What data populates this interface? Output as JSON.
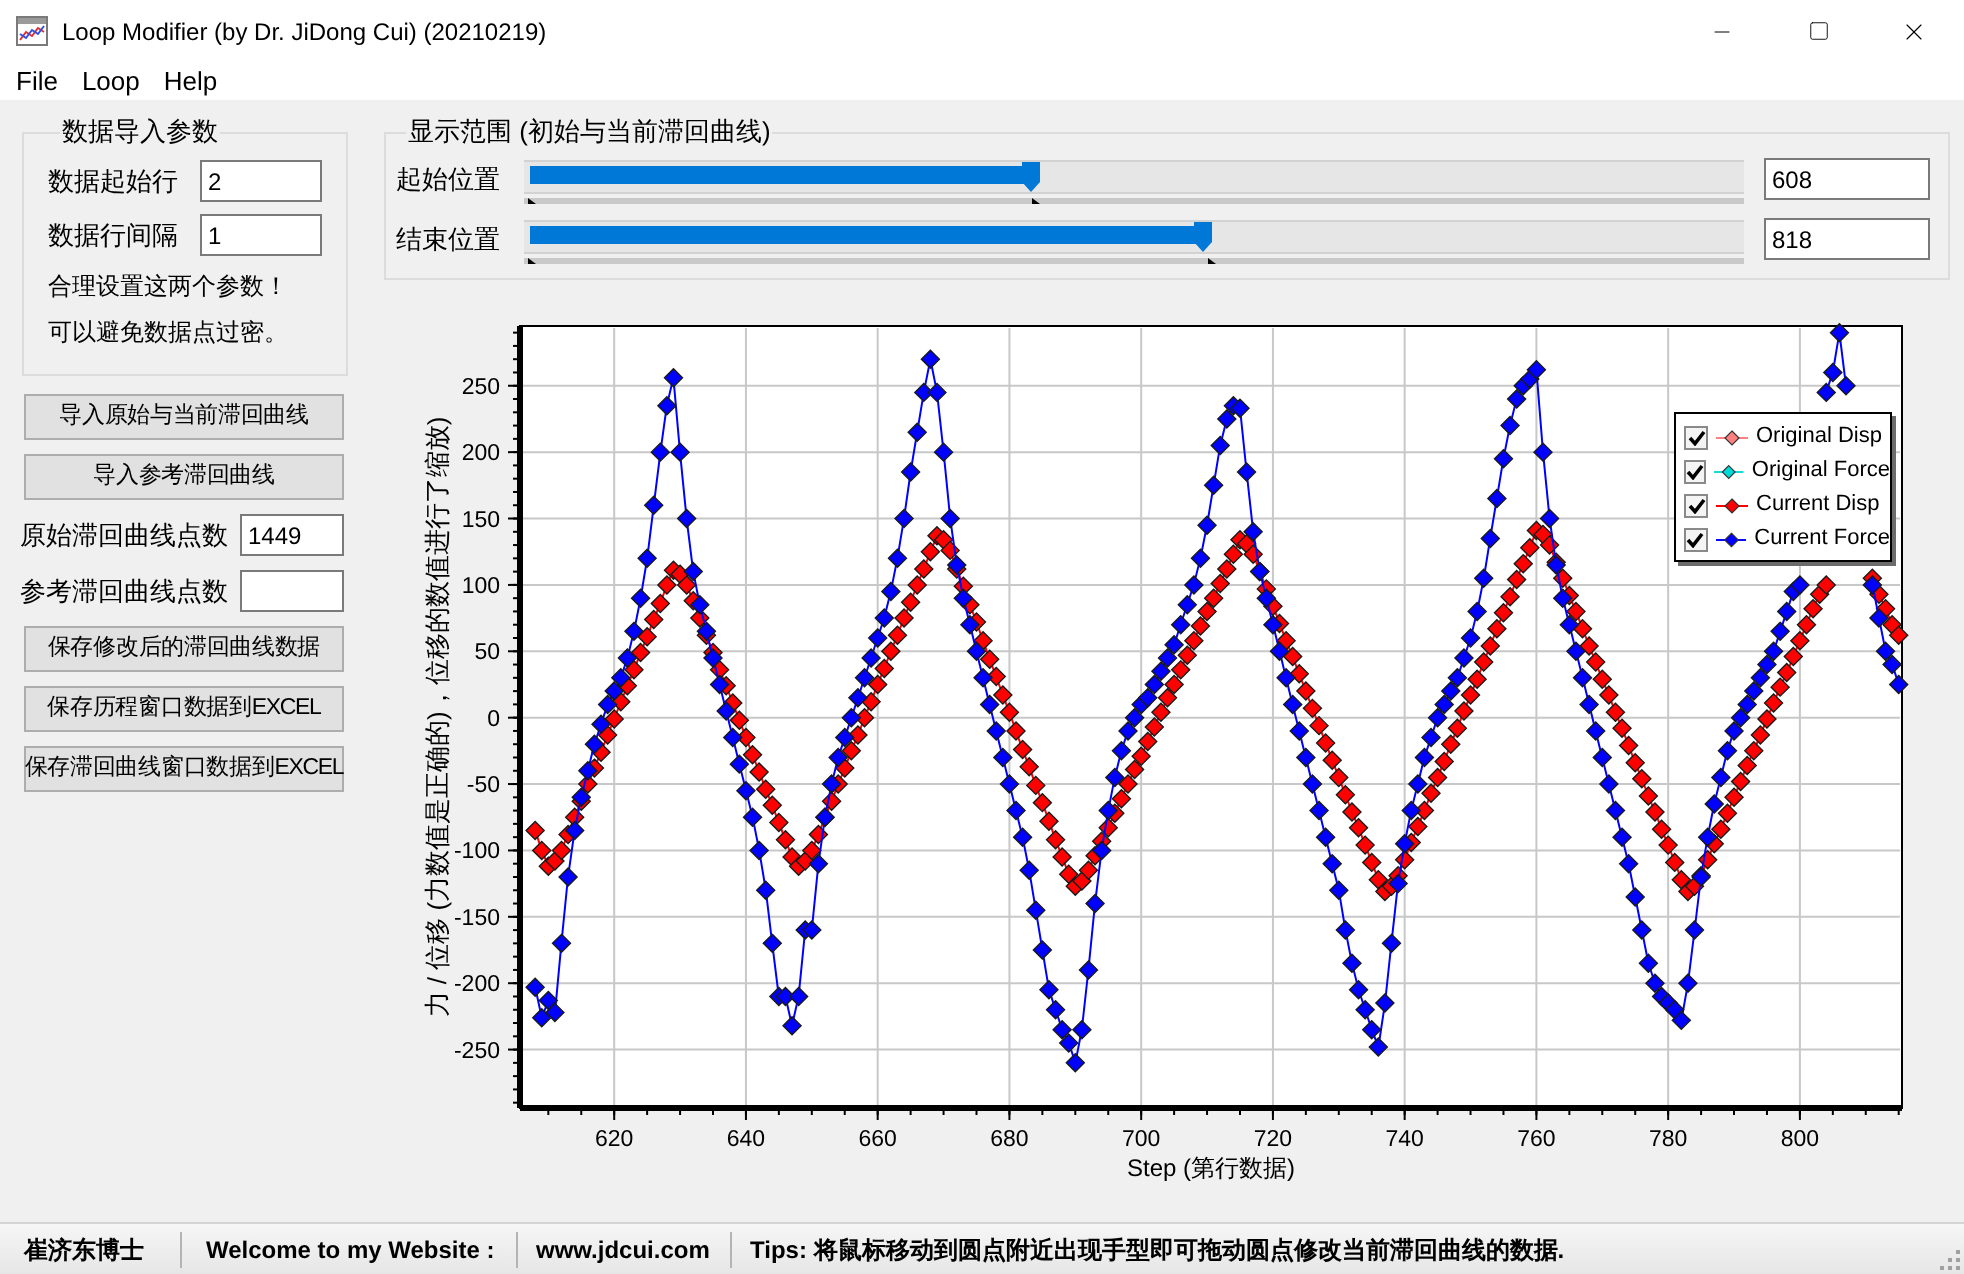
{
  "window": {
    "title": "Loop Modifier (by Dr. JiDong Cui) (20210219)"
  },
  "menu": [
    "File",
    "Loop",
    "Help"
  ],
  "import_params": {
    "title": "数据导入参数",
    "fields": [
      {
        "label": "数据起始行",
        "value": "2"
      },
      {
        "label": "数据行间隔",
        "value": "1"
      }
    ],
    "notes": [
      "合理设置这两个参数！",
      "可以避免数据点过密。"
    ]
  },
  "actions": [
    {
      "kind": "button",
      "label": "导入原始与当前滞回曲线"
    },
    {
      "kind": "button",
      "label": "导入参考滞回曲线"
    },
    {
      "kind": "field",
      "label": "原始滞回曲线点数",
      "value": "1449"
    },
    {
      "kind": "field",
      "label": "参考滞回曲线点数"
    },
    {
      "kind": "button",
      "label": "保存修改后的滞回曲线数据"
    },
    {
      "kind": "button",
      "label": "保存历程窗口数据到EXCEL"
    },
    {
      "kind": "button",
      "label": "保存滞回曲线窗口数据到EXCEL"
    }
  ],
  "display_range": {
    "title": "显示范围 (初始与当前滞回曲线)",
    "sliders": [
      {
        "label": "起始位置",
        "level": 0.42,
        "value": "608"
      },
      {
        "label": "结束位置",
        "level": 0.565,
        "value": "818"
      }
    ]
  },
  "chart": {
    "legend": [
      {
        "label": "Original Disp",
        "checked": true,
        "color": "#ff8080"
      },
      {
        "label": "Original Force",
        "checked": true,
        "color": "#00d8d8"
      },
      {
        "label": "Current Disp",
        "checked": true,
        "color": "#ff0000"
      },
      {
        "label": "Current Force",
        "checked": true,
        "color": "#0000ff"
      }
    ],
    "chart_data": {
      "type": "line",
      "grid": true,
      "xlabel": "Step (第行数据)",
      "ylabel": "力 / 位移 (力数值是正确的)，位移的数值进行了缩放)",
      "xlim": [
        605.7,
        815.5
      ],
      "ylim": [
        -294,
        295
      ],
      "xticks": [
        620,
        640,
        660,
        680,
        700,
        720,
        740,
        760,
        780,
        800
      ],
      "yticks": [
        -250,
        -200,
        -150,
        -100,
        -50,
        0,
        50,
        100,
        150,
        200,
        250
      ],
      "x": [
        608,
        609,
        610,
        611,
        612,
        613,
        614,
        615,
        616,
        617,
        618,
        619,
        620,
        621,
        622,
        623,
        624,
        625,
        626,
        627,
        628,
        629,
        630,
        631,
        632,
        633,
        634,
        635,
        636,
        637,
        638,
        639,
        640,
        641,
        642,
        643,
        644,
        645,
        646,
        647,
        648,
        649,
        650,
        651,
        652,
        653,
        654,
        655,
        656,
        657,
        658,
        659,
        660,
        661,
        662,
        663,
        664,
        665,
        666,
        667,
        668,
        669,
        670,
        671,
        672,
        673,
        674,
        675,
        676,
        677,
        678,
        679,
        680,
        681,
        682,
        683,
        684,
        685,
        686,
        687,
        688,
        689,
        690,
        691,
        692,
        693,
        694,
        695,
        696,
        697,
        698,
        699,
        700,
        701,
        702,
        703,
        704,
        705,
        706,
        707,
        708,
        709,
        710,
        711,
        712,
        713,
        714,
        715,
        716,
        717,
        718,
        719,
        720,
        721,
        722,
        723,
        724,
        725,
        726,
        727,
        728,
        729,
        730,
        731,
        732,
        733,
        734,
        735,
        736,
        737,
        738,
        739,
        740,
        741,
        742,
        743,
        744,
        745,
        746,
        747,
        748,
        749,
        750,
        751,
        752,
        753,
        754,
        755,
        756,
        757,
        758,
        759,
        760,
        761,
        762,
        763,
        764,
        765,
        766,
        767,
        768,
        769,
        770,
        771,
        772,
        773,
        774,
        775,
        776,
        777,
        778,
        779,
        780,
        781,
        782,
        783,
        784,
        785,
        786,
        787,
        788,
        789,
        790,
        791,
        792,
        793,
        794,
        795,
        796,
        797,
        798,
        799,
        800,
        801,
        802,
        803,
        804,
        805,
        806,
        807,
        808,
        809,
        810,
        811,
        812,
        813,
        814,
        815
      ],
      "series": [
        {
          "color": "#ff0000",
          "marker": "diamond",
          "values": [
            -85,
            -100,
            -112,
            -108,
            -100,
            -88,
            -75,
            -63,
            -50,
            -38,
            -26,
            -13,
            -1,
            12,
            24,
            36,
            49,
            61,
            74,
            86,
            100,
            111,
            108,
            100,
            88,
            75,
            62,
            49,
            36,
            24,
            11,
            -2,
            -15,
            -28,
            -41,
            -54,
            -66,
            -79,
            -92,
            -105,
            -112,
            -108,
            -100,
            -88,
            -75,
            -63,
            -50,
            -38,
            -25,
            -13,
            0,
            12,
            25,
            37,
            50,
            62,
            75,
            87,
            100,
            112,
            125,
            137,
            134,
            126,
            112,
            99,
            85,
            72,
            58,
            44,
            31,
            17,
            4,
            -10,
            -24,
            -37,
            -51,
            -64,
            -78,
            -92,
            -105,
            -118,
            -127,
            -123,
            -115,
            -104,
            -93,
            -83,
            -72,
            -61,
            -50,
            -39,
            -29,
            -18,
            -7,
            4,
            15,
            25,
            36,
            47,
            58,
            69,
            80,
            90,
            101,
            112,
            123,
            134,
            131,
            123,
            110,
            97,
            84,
            71,
            58,
            46,
            33,
            20,
            7,
            -6,
            -19,
            -32,
            -45,
            -58,
            -71,
            -83,
            -96,
            -109,
            -122,
            -131,
            -127,
            -119,
            -107,
            -94,
            -82,
            -70,
            -57,
            -45,
            -33,
            -20,
            -8,
            5,
            17,
            29,
            42,
            54,
            67,
            79,
            91,
            104,
            116,
            128,
            141,
            138,
            130,
            117,
            105,
            92,
            80,
            67,
            54,
            42,
            29,
            17,
            4,
            -8,
            -21,
            -34,
            -46,
            -59,
            -71,
            -84,
            -96,
            -109,
            -122,
            -131,
            -127,
            -119,
            -107,
            -95,
            -84,
            -72,
            -60,
            -48,
            -36,
            -25,
            -13,
            -1,
            11,
            23,
            34,
            46,
            58,
            70,
            82,
            93,
            100,
            null,
            null,
            null,
            null,
            null,
            null,
            105,
            93,
            82,
            70,
            62
          ]
        },
        {
          "color": "#0000ff",
          "marker": "diamond",
          "values": [
            -203,
            -226,
            -213,
            -222,
            -170,
            -120,
            -85,
            -60,
            -40,
            -20,
            -5,
            10,
            20,
            30,
            45,
            65,
            90,
            120,
            160,
            200,
            235,
            256,
            200,
            150,
            110,
            85,
            65,
            45,
            25,
            5,
            -15,
            -35,
            -55,
            -75,
            -100,
            -130,
            -170,
            -210,
            -210,
            -232,
            -210,
            -160,
            -160,
            -110,
            -75,
            -50,
            -30,
            -15,
            0,
            15,
            30,
            45,
            60,
            75,
            95,
            120,
            150,
            185,
            215,
            245,
            270,
            245,
            200,
            150,
            115,
            90,
            70,
            50,
            30,
            10,
            -10,
            -30,
            -50,
            -70,
            -90,
            -115,
            -145,
            -175,
            -205,
            -220,
            -235,
            -245,
            -260,
            -235,
            -190,
            -140,
            -100,
            -70,
            -45,
            -25,
            -10,
            0,
            10,
            15,
            25,
            35,
            45,
            55,
            70,
            85,
            100,
            120,
            145,
            175,
            205,
            225,
            235,
            233,
            185,
            140,
            110,
            90,
            70,
            50,
            30,
            10,
            -10,
            -30,
            -50,
            -70,
            -90,
            -110,
            -130,
            -160,
            -185,
            -205,
            -220,
            -235,
            -248,
            -215,
            -170,
            -125,
            -95,
            -70,
            -50,
            -30,
            -15,
            0,
            10,
            20,
            30,
            45,
            60,
            80,
            105,
            135,
            165,
            195,
            220,
            240,
            250,
            255,
            262,
            200,
            150,
            115,
            90,
            70,
            50,
            30,
            10,
            -10,
            -30,
            -50,
            -70,
            -90,
            -110,
            -135,
            -160,
            -185,
            -200,
            -210,
            -215,
            -220,
            -228,
            -200,
            -160,
            -120,
            -90,
            -65,
            -45,
            -25,
            -10,
            0,
            10,
            20,
            30,
            40,
            50,
            65,
            80,
            95,
            100,
            null,
            null,
            null,
            245,
            260,
            290,
            250,
            null,
            null,
            null,
            100,
            75,
            50,
            40,
            25
          ]
        }
      ]
    }
  },
  "status_bar": [
    "崔济东博士",
    "Welcome to my Website :",
    "www.jdcui.com",
    "Tips: 将鼠标移动到圆点附近出现手型即可拖动圆点修改当前滞回曲线的数据."
  ]
}
